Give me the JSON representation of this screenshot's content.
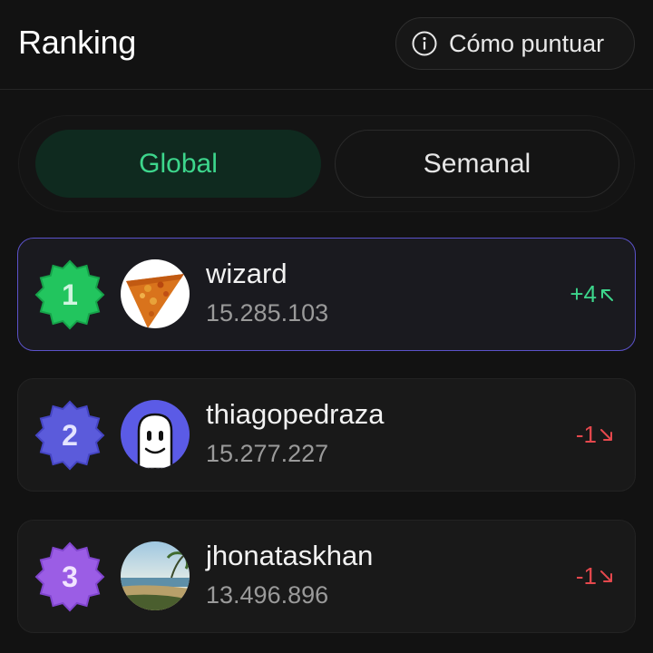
{
  "header": {
    "title": "Ranking",
    "howto_label": "Cómo puntuar",
    "howto_icon": "info-icon"
  },
  "tabs": [
    {
      "label": "Global",
      "active": true
    },
    {
      "label": "Semanal",
      "active": false
    }
  ],
  "colors": {
    "accent_green": "#3dd68c",
    "accent_red": "#e5484d",
    "rank1_badge": "#22c55e",
    "rank2_badge": "#5b5bdb",
    "rank3_badge": "#9b5de5",
    "highlight_border": "#5b52c9"
  },
  "rankings": [
    {
      "rank": "1",
      "username": "wizard",
      "score": "15.285.103",
      "change": "+4",
      "direction": "up",
      "avatar": "pizza-avatar"
    },
    {
      "rank": "2",
      "username": "thiagopedraza",
      "score": "15.277.227",
      "change": "-1",
      "direction": "down",
      "avatar": "ghost-avatar"
    },
    {
      "rank": "3",
      "username": "jhonataskhan",
      "score": "13.496.896",
      "change": "-1",
      "direction": "down",
      "avatar": "beach-avatar"
    }
  ]
}
